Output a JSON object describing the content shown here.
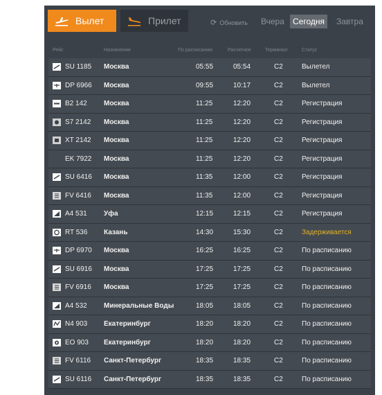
{
  "header": {
    "tab_departures": "Вылет",
    "tab_arrivals": "Прилет",
    "refresh_label": "Обновить",
    "day_yesterday": "Вчера",
    "day_today": "Сегодня",
    "day_tomorrow": "Завтра"
  },
  "columns": {
    "flight": "Рейс",
    "destination": "Назначение",
    "scheduled": "По расписанию",
    "estimated": "Расчетное",
    "terminal": "Терминал",
    "status": "Статус"
  },
  "colors": {
    "accent": "#f08a1d",
    "board_bg": "#3b4148",
    "delayed": "#e0b02a"
  },
  "flights": [
    {
      "logo_icon": "airline-logo-aeroflot-icon",
      "flight": "SU 1185",
      "destination": "Москва",
      "scheduled": "05:55",
      "estimated": "05:54",
      "terminal": "C2",
      "status": "Вылетел"
    },
    {
      "logo_icon": "airline-logo-dp-icon",
      "flight": "DP 6966",
      "destination": "Москва",
      "scheduled": "09:55",
      "estimated": "10:17",
      "terminal": "C2",
      "status": "Вылетел"
    },
    {
      "logo_icon": "airline-logo-b2-icon",
      "flight": "B2 142",
      "destination": "Москва",
      "scheduled": "11:25",
      "estimated": "12:20",
      "terminal": "C2",
      "status": "Регистрация"
    },
    {
      "logo_icon": "airline-logo-s7-icon",
      "flight": "S7 2142",
      "destination": "Москва",
      "scheduled": "11:25",
      "estimated": "12:20",
      "terminal": "C2",
      "status": "Регистрация"
    },
    {
      "logo_icon": "airline-logo-xt-icon",
      "flight": "XT 2142",
      "destination": "Москва",
      "scheduled": "11:25",
      "estimated": "12:20",
      "terminal": "C2",
      "status": "Регистрация"
    },
    {
      "logo_icon": "airline-logo-blank-icon",
      "flight": "EK 7922",
      "destination": "Москва",
      "scheduled": "11:25",
      "estimated": "12:20",
      "terminal": "C2",
      "status": "Регистрация"
    },
    {
      "logo_icon": "airline-logo-aeroflot-icon",
      "flight": "SU 6416",
      "destination": "Москва",
      "scheduled": "11:35",
      "estimated": "12:00",
      "terminal": "C2",
      "status": "Регистрация"
    },
    {
      "logo_icon": "airline-logo-rossiya-icon",
      "flight": "FV 6416",
      "destination": "Москва",
      "scheduled": "11:35",
      "estimated": "12:00",
      "terminal": "C2",
      "status": "Регистрация"
    },
    {
      "logo_icon": "airline-logo-a4-icon",
      "flight": "A4 531",
      "destination": "Уфа",
      "scheduled": "12:15",
      "estimated": "12:15",
      "terminal": "C2",
      "status": "Регистрация"
    },
    {
      "logo_icon": "airline-logo-rt-icon",
      "flight": "RT 536",
      "destination": "Казань",
      "scheduled": "14:30",
      "estimated": "15:30",
      "terminal": "C2",
      "status": "Задерживается",
      "delayed": true
    },
    {
      "logo_icon": "airline-logo-dp-icon",
      "flight": "DP 6970",
      "destination": "Москва",
      "scheduled": "16:25",
      "estimated": "16:25",
      "terminal": "C2",
      "status": "По расписанию"
    },
    {
      "logo_icon": "airline-logo-aeroflot-icon",
      "flight": "SU 6916",
      "destination": "Москва",
      "scheduled": "17:25",
      "estimated": "17:25",
      "terminal": "C2",
      "status": "По расписанию"
    },
    {
      "logo_icon": "airline-logo-rossiya-icon",
      "flight": "FV 6916",
      "destination": "Москва",
      "scheduled": "17:25",
      "estimated": "17:25",
      "terminal": "C2",
      "status": "По расписанию"
    },
    {
      "logo_icon": "airline-logo-a4-icon",
      "flight": "A4 532",
      "destination": "Минеральные Воды",
      "scheduled": "18:05",
      "estimated": "18:05",
      "terminal": "C2",
      "status": "По расписанию"
    },
    {
      "logo_icon": "airline-logo-n4-icon",
      "flight": "N4 903",
      "destination": "Екатеринбург",
      "scheduled": "18:20",
      "estimated": "18:20",
      "terminal": "C2",
      "status": "По расписанию"
    },
    {
      "logo_icon": "airline-logo-eo-icon",
      "flight": "EO 903",
      "destination": "Екатеринбург",
      "scheduled": "18:20",
      "estimated": "18:20",
      "terminal": "C2",
      "status": "По расписанию"
    },
    {
      "logo_icon": "airline-logo-rossiya-icon",
      "flight": "FV 6116",
      "destination": "Санкт-Петербург",
      "scheduled": "18:35",
      "estimated": "18:35",
      "terminal": "C2",
      "status": "По расписанию"
    },
    {
      "logo_icon": "airline-logo-aeroflot-icon",
      "flight": "SU 6116",
      "destination": "Санкт-Петербург",
      "scheduled": "18:35",
      "estimated": "18:35",
      "terminal": "C2",
      "status": "По расписанию"
    }
  ]
}
